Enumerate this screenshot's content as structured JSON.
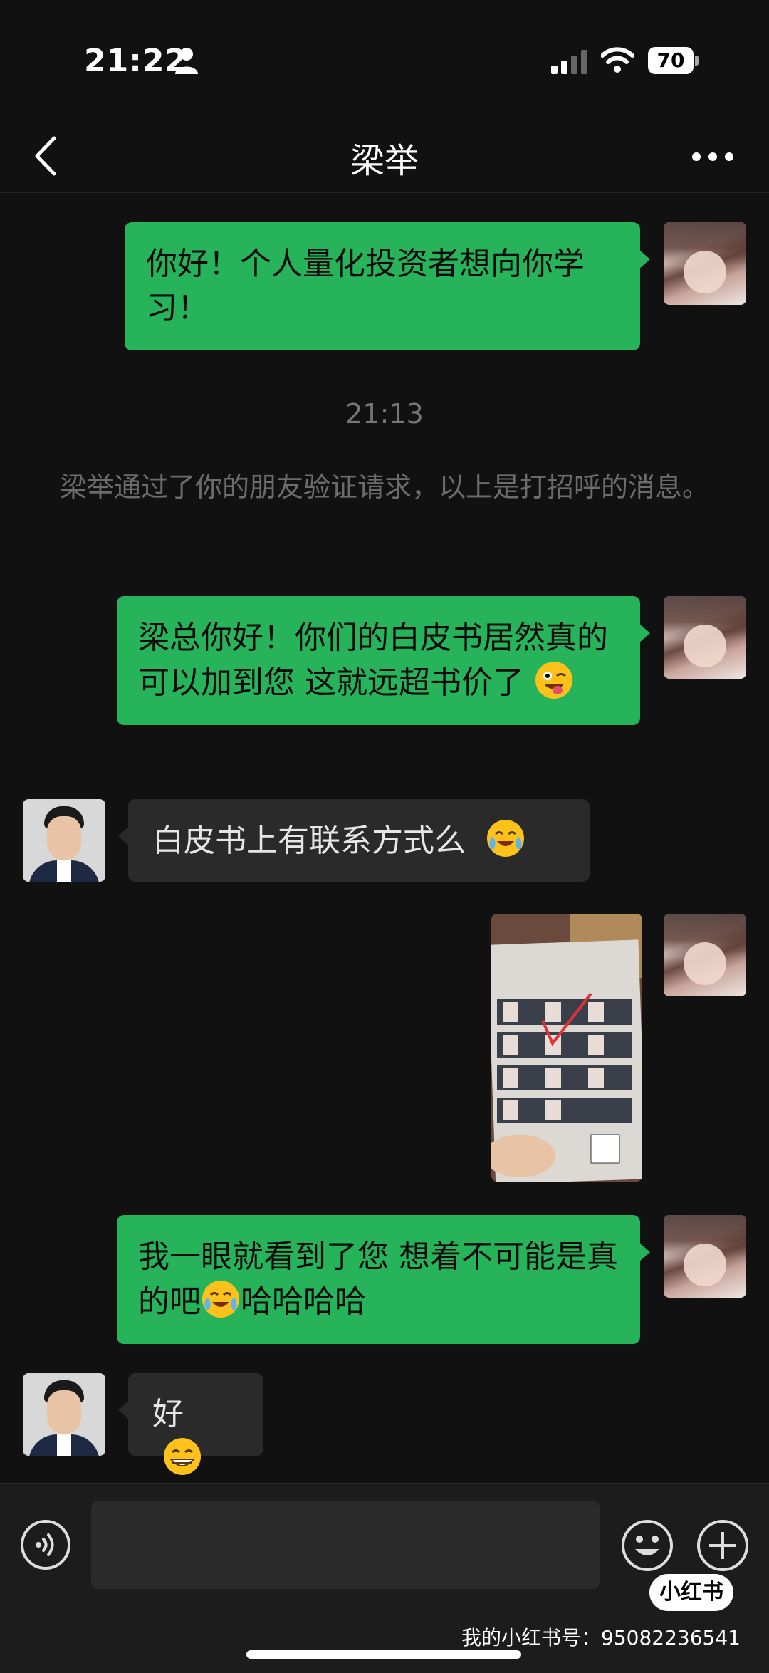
{
  "status_bar": {
    "time": "21:22",
    "battery": "70"
  },
  "nav": {
    "title": "梁举"
  },
  "messages": {
    "m1": "你好！个人量化投资者想向你学习！",
    "timestamp": "21:13",
    "system": "梁举通过了你的朋友验证请求，以上是打招呼的消息。",
    "m2": "梁总你好！你们的白皮书居然真的可以加到您 这就远超书价了",
    "m3": "白皮书上有联系方式么",
    "m4_part1": "我一眼就看到了您 想着不可能是真的吧",
    "m4_part2": "哈哈哈哈",
    "m5": "好"
  },
  "icons": {
    "back": "chevron-left-icon",
    "more": "more-dots-icon",
    "voice": "voice-icon",
    "emoji": "emoji-icon",
    "plus": "plus-icon"
  },
  "overlay": {
    "logo": "小红书",
    "watermark": "我的小红书号：95082236541"
  },
  "colors": {
    "outgoing_bubble": "#26b35a",
    "incoming_bubble": "#2a2a2a",
    "background": "#111111"
  }
}
